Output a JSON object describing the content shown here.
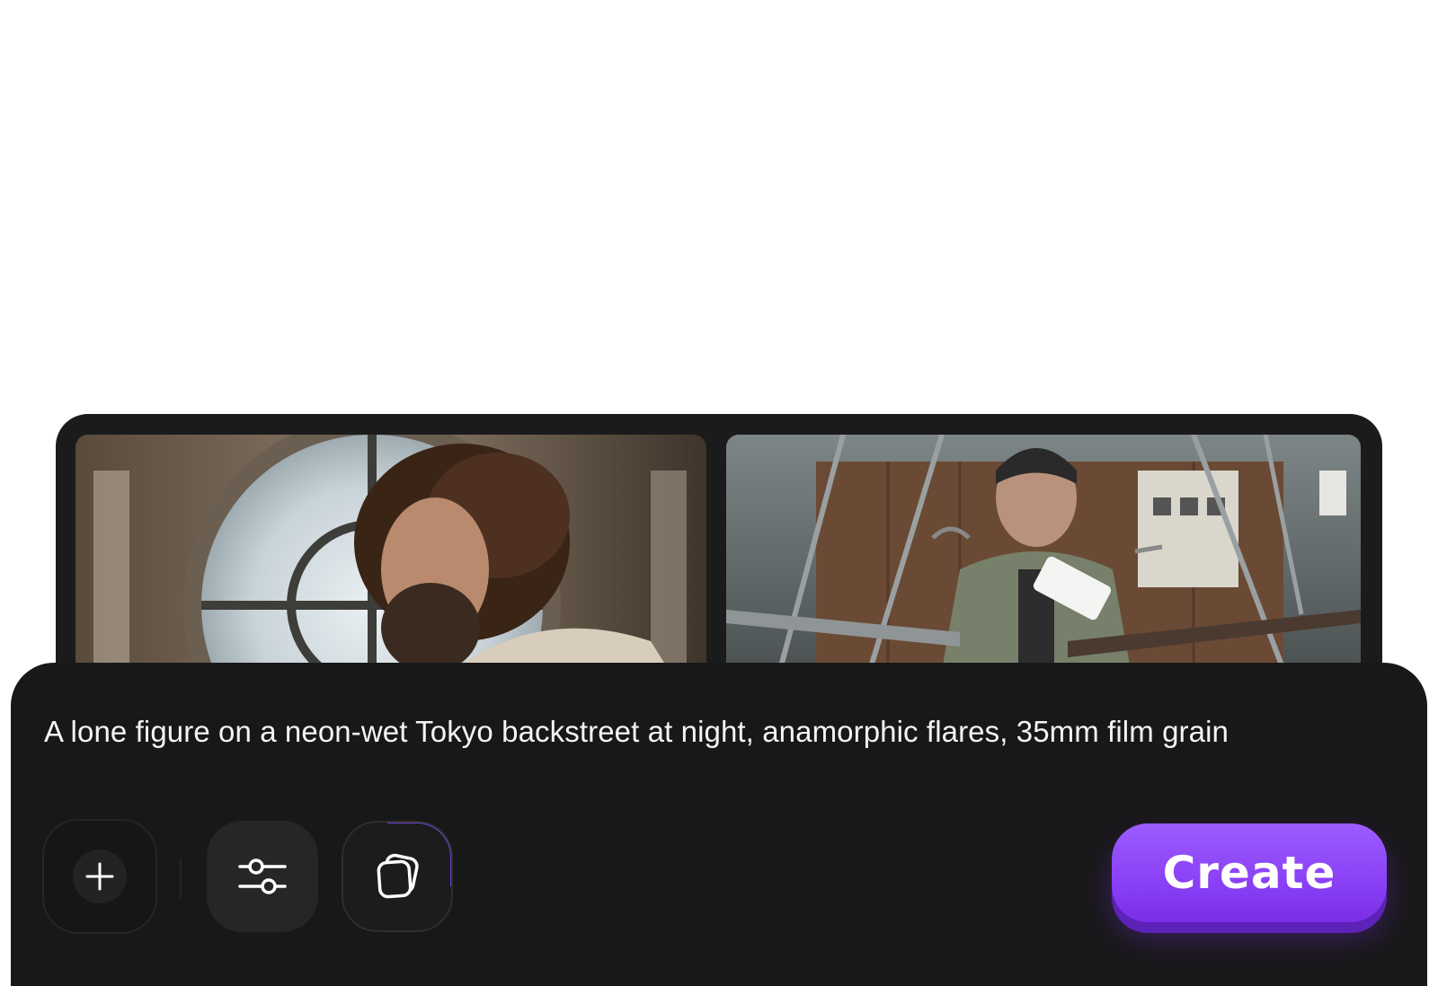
{
  "composer": {
    "prompt": "A lone figure on a neon-wet Tokyo backstreet at night, anamorphic flares, 35mm film grain",
    "create_label": "Create"
  },
  "toolbar": {
    "add_icon": "plus-icon",
    "settings_icon": "sliders-icon",
    "style_icon": "stacked-cards-icon"
  },
  "colors": {
    "accent": "#8a40f5",
    "panel": "#181818",
    "frame": "#1b1b1c"
  }
}
